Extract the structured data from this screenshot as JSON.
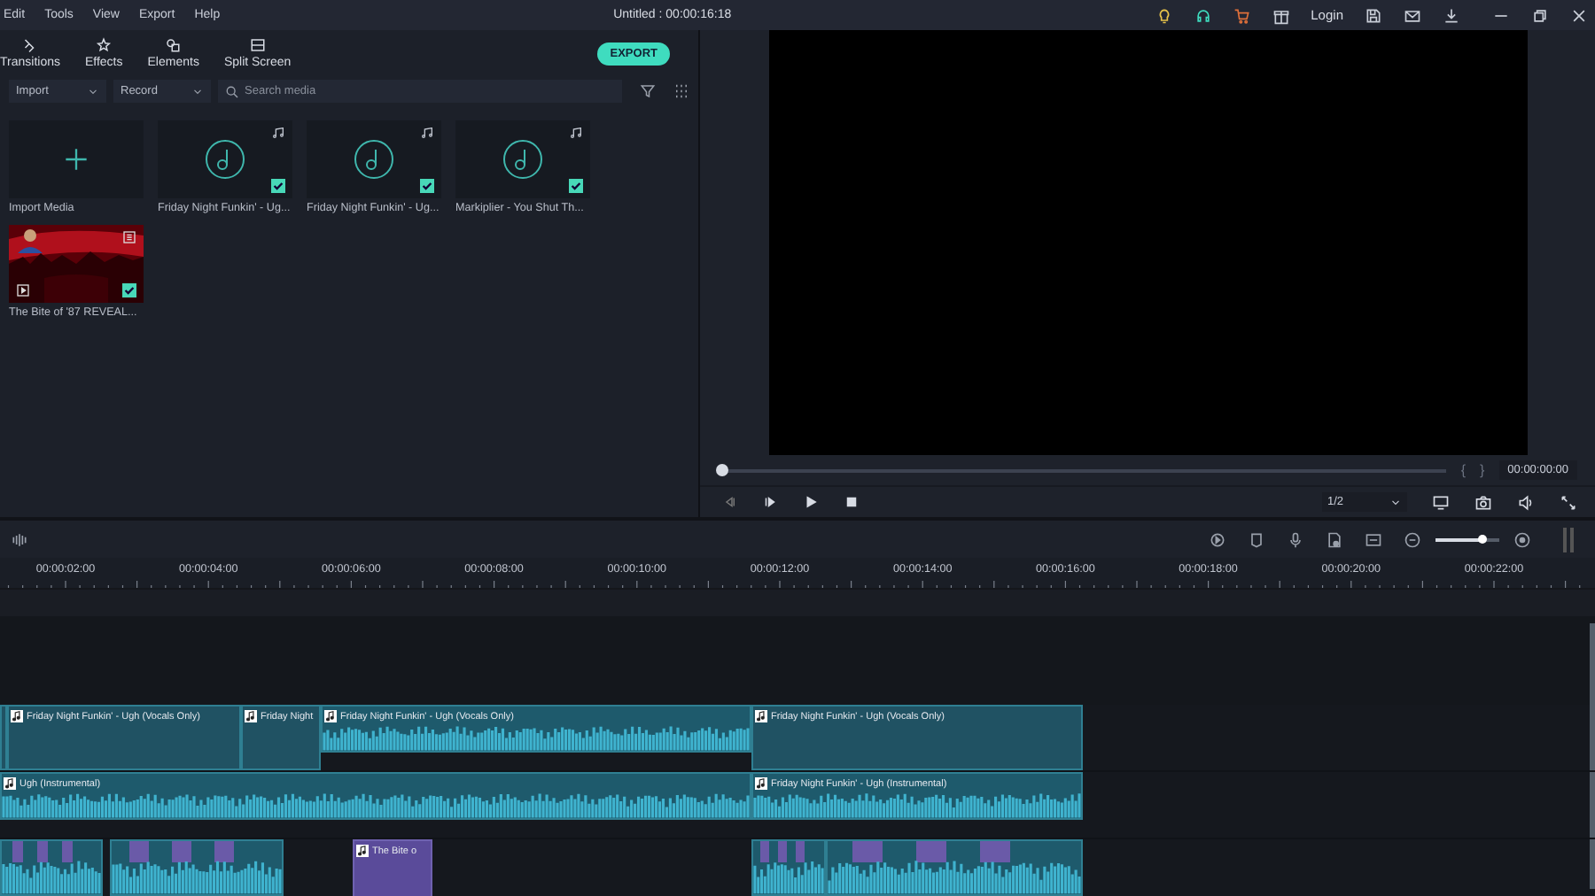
{
  "menu": [
    "Edit",
    "Tools",
    "View",
    "Export",
    "Help"
  ],
  "title": "Untitled : 00:00:16:18",
  "login": "Login",
  "tabs": [
    {
      "label": "Transitions"
    },
    {
      "label": "Effects"
    },
    {
      "label": "Elements"
    },
    {
      "label": "Split Screen"
    }
  ],
  "export_button": "EXPORT",
  "dropdowns": [
    "Import",
    "Record"
  ],
  "search": {
    "placeholder": "Search media"
  },
  "media": [
    {
      "kind": "import",
      "label": "Import Media"
    },
    {
      "kind": "audio",
      "label": "Friday Night Funkin' - Ug...",
      "checked": true
    },
    {
      "kind": "audio",
      "label": "Friday Night Funkin' - Ug...",
      "checked": true
    },
    {
      "kind": "audio",
      "label": "Markiplier - You Shut Th...",
      "checked": true
    },
    {
      "kind": "video",
      "label": "The Bite of '87 REVEAL...",
      "checked": true
    }
  ],
  "preview": {
    "scrubber": {
      "level": 0
    },
    "in_mark": "{",
    "out_mark": "}",
    "time": "00:00:00:00",
    "quality": "1/2"
  },
  "timeline": {
    "zoom": {
      "level": 0.73
    },
    "ruler": [
      "00:00:02:00",
      "00:00:04:00",
      "00:00:06:00",
      "00:00:08:00",
      "00:00:10:00",
      "00:00:12:00",
      "00:00:14:00",
      "00:00:16:00",
      "00:00:18:00",
      "00:00:20:00",
      "00:00:22:00"
    ],
    "tracks": [
      {
        "clips": [
          {
            "kind": "plain"
          },
          {
            "kind": "plain",
            "title": "Friday Night Funkin' - Ugh (Vocals Only)"
          },
          {
            "kind": "plain",
            "title": "Friday Night"
          },
          {
            "kind": "wave",
            "title": "Friday Night Funkin' - Ugh (Vocals Only)"
          },
          {
            "kind": "plain",
            "title": "Friday Night Funkin' - Ugh (Vocals Only)"
          }
        ]
      },
      {
        "clips": [
          {
            "kind": "wave",
            "title": "Ugh (Instrumental)"
          },
          {
            "kind": "wave",
            "title": "Friday Night Funkin' - Ugh (Instrumental)"
          }
        ]
      },
      {
        "clips": [
          {
            "kind": "mixed"
          },
          {
            "kind": "mixed"
          },
          {
            "kind": "video",
            "title": "The Bite o"
          },
          {
            "kind": "mixed"
          },
          {
            "kind": "mixed"
          }
        ]
      }
    ]
  }
}
